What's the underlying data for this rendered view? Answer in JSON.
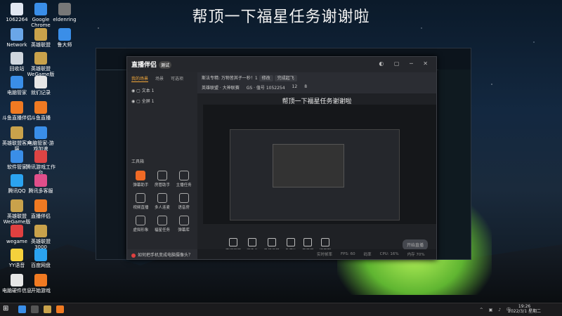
{
  "overlay_title": "帮顶一下福星任务谢谢啦",
  "desktop_icons": [
    {
      "label": "1062264",
      "color": "#e0e6f0"
    },
    {
      "label": "Google Chrome",
      "color": "#3a8ee8"
    },
    {
      "label": "eldenring",
      "color": "#777"
    },
    {
      "label": "Network",
      "color": "#6aa6e8"
    },
    {
      "label": "英雄联盟",
      "color": "#c9a24b"
    },
    {
      "label": "鲁大师",
      "color": "#3a8ee8"
    },
    {
      "label": "回收站",
      "color": "#cfd6de"
    },
    {
      "label": "英雄联盟 WeGame版",
      "color": "#c9a24b"
    },
    {
      "label": "电脑管家",
      "color": "#3a8ee8"
    },
    {
      "label": "就们记录",
      "color": "#e6e6e6"
    },
    {
      "label": "斗鱼直播伴侣",
      "color": "#f07a22"
    },
    {
      "label": "斗鱼直播",
      "color": "#f07a22"
    },
    {
      "label": "英雄联盟客户端",
      "color": "#c9a24b"
    },
    {
      "label": "电脑管家-游戏加速",
      "color": "#3a8ee8"
    },
    {
      "label": "软件管家",
      "color": "#3a8ee8"
    },
    {
      "label": "腾讯游戏工作台",
      "color": "#d44"
    },
    {
      "label": "腾讯QQ",
      "color": "#2ba3f0"
    },
    {
      "label": "腾讯多客服",
      "color": "#e04e8a"
    },
    {
      "label": "英雄联盟 WeGame版",
      "color": "#c9a24b"
    },
    {
      "label": "直播伴侣",
      "color": "#f07a22"
    },
    {
      "label": "wegame",
      "color": "#e04040"
    },
    {
      "label": "英雄联盟 3000",
      "color": "#c9a24b"
    },
    {
      "label": "YY语音",
      "color": "#f5d13c"
    },
    {
      "label": "百度网盘",
      "color": "#2ba3f0"
    },
    {
      "label": "电脑硬件信息",
      "color": "#e6e6e6"
    },
    {
      "label": "开始游戏",
      "color": "#f07a22"
    }
  ],
  "app": {
    "logo": "直播伴侣",
    "logo_badge": "测试",
    "window_buttons": "◐ ▢ ─ ✕",
    "left_tabs": [
      "我的场景",
      "场景",
      "可选项"
    ],
    "scenes": [
      "文本 1",
      "全屏 1"
    ],
    "tools_title": "工具箱",
    "tools": [
      {
        "label": "弹幕助手",
        "hot": true
      },
      {
        "label": "房管助手",
        "hot": false
      },
      {
        "label": "主播任务",
        "hot": false
      },
      {
        "label": "视频直播",
        "hot": false
      },
      {
        "label": "多人连麦",
        "hot": false
      },
      {
        "label": "语音房",
        "hot": false
      },
      {
        "label": "虚拟形象",
        "hot": false
      },
      {
        "label": "福星任务",
        "hot": false
      },
      {
        "label": "弹幕库",
        "hot": false
      }
    ],
    "main_head_title": "斯法专精: 万物皆其子一秒！1",
    "main_head_btn1": "修改",
    "main_head_btn2": "完成起飞",
    "main_head_row2": [
      "英雄联盟 · 大神联赛",
      "GS · 值号 1052254",
      "12",
      "8"
    ],
    "preview_title": "帮顶一下福星任务谢谢啦",
    "controls": [
      "直播画面",
      "摄像头",
      "手机投屏",
      "多媒体",
      "麦克风",
      "扬声器"
    ],
    "live_button": "开始直播",
    "status": [
      "实时帧率",
      "FPS: 60",
      "码率",
      "CPU: 16%",
      "内存 70%"
    ],
    "camera_tip": "如何把手机变成电脑摄像头？"
  },
  "taskbar": {
    "start_icon": "windows-icon",
    "time": "19:26",
    "date": "2022/3/1 星期二",
    "tray": "^ ▣ ♪ 中"
  }
}
